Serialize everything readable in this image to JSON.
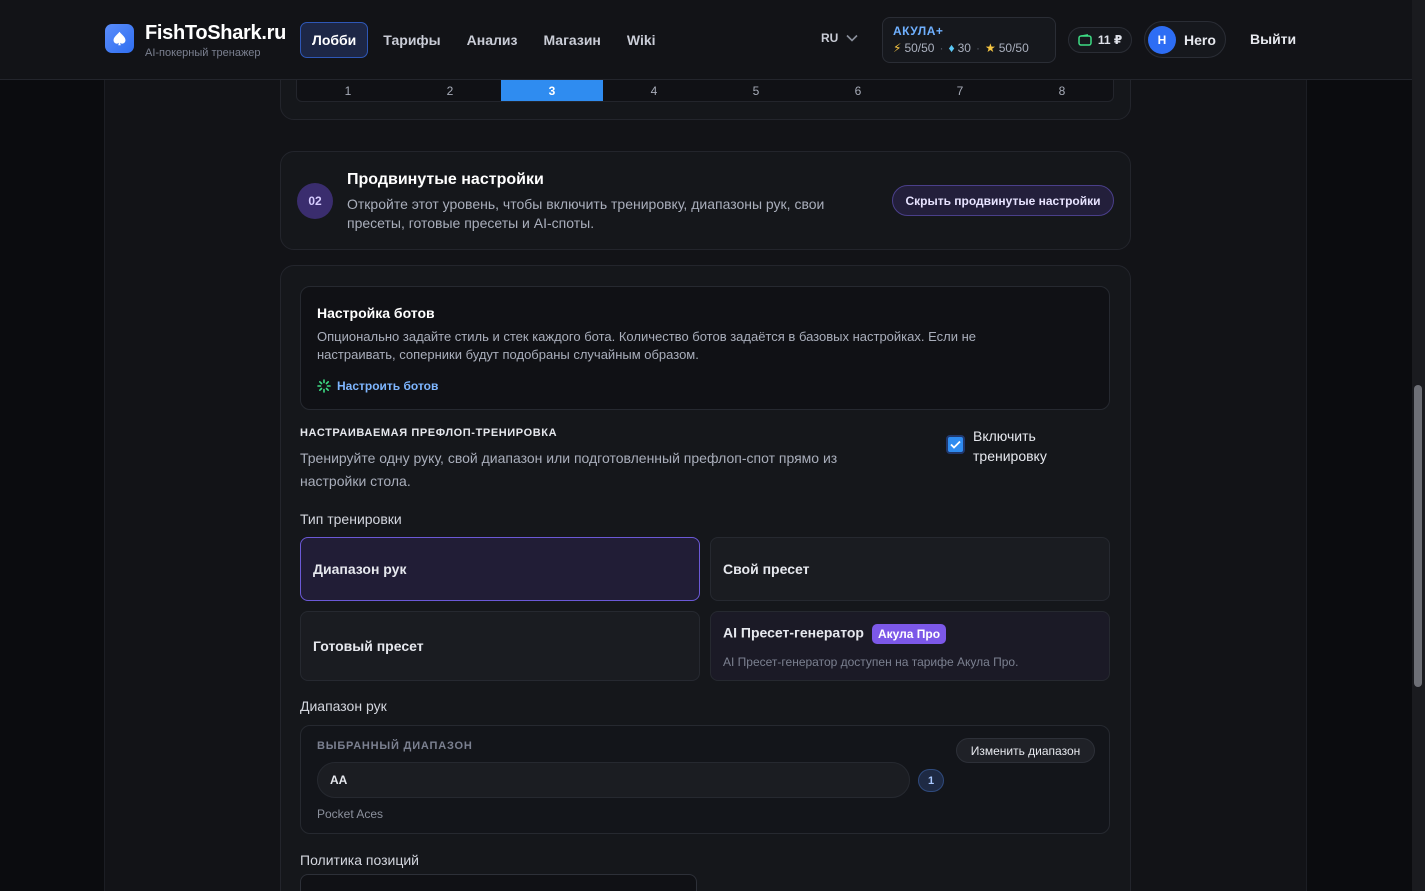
{
  "header": {
    "brand": "FishToShark.ru",
    "tagline": "AI-покерный тренажер",
    "nav": [
      "Лобби",
      "Тарифы",
      "Анализ",
      "Магазин",
      "Wiki"
    ],
    "lang": "RU",
    "plan": {
      "name": "АКУЛА+",
      "energy": "50/50",
      "gems": "30",
      "stars": "50/50"
    },
    "wallet": "11 ₽",
    "user": {
      "initial": "H",
      "name": "Hero"
    },
    "logout": "Выйти"
  },
  "stepper": {
    "steps": [
      "1",
      "2",
      "3",
      "4",
      "5",
      "6",
      "7",
      "8"
    ],
    "active": "3"
  },
  "advanced": {
    "number": "02",
    "title": "Продвинутые настройки",
    "description": "Откройте этот уровень, чтобы включить тренировку, диапазоны рук, свои пресеты, готовые пресеты и AI-споты.",
    "hide_label": "Скрыть продвинутые настройки"
  },
  "bots": {
    "title": "Настройка ботов",
    "description": "Опционально задайте стиль и стек каждого бота. Количество ботов задаётся в базовых настройках. Если не настраивать, соперники будут подобраны случайным образом.",
    "link": "Настроить ботов"
  },
  "training": {
    "caption": "НАСТРАИВАЕМАЯ ПРЕФЛОП-ТРЕНИРОВКА",
    "description": "Тренируйте одну руку, свой диапазон или подготовленный префлоп-спот прямо из настройки стола.",
    "enable_label": "Включить тренировку",
    "enabled": true,
    "type_label": "Тип тренировки",
    "options": {
      "range": "Диапазон рук",
      "own_preset": "Свой пресет",
      "ready_preset": "Готовый пресет",
      "ai_generator": "AI Пресет-генератор",
      "ai_badge": "Акула Про",
      "ai_note": "AI Пресет-генератор доступен на тарифе Акула Про."
    },
    "range_label": "Диапазон рук",
    "range_box": {
      "caption": "ВЫБРАННЫЙ ДИАПАЗОН",
      "value": "AA",
      "count": "1",
      "note": "Pocket Aces",
      "change_label": "Изменить диапазон"
    },
    "positions_label": "Политика позиций"
  }
}
